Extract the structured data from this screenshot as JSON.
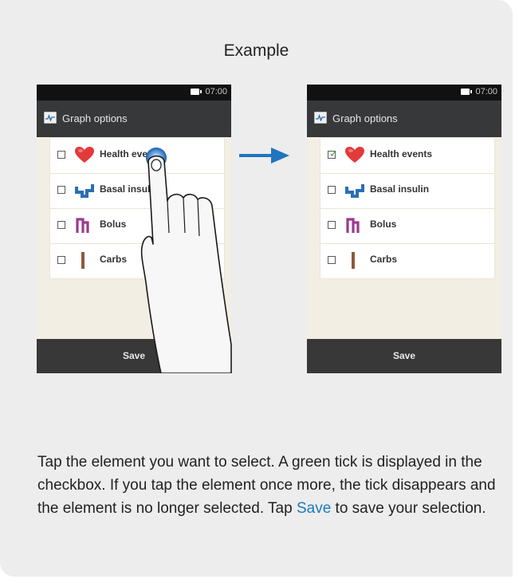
{
  "example_title": "Example",
  "phones": {
    "left": {
      "clock": "07:00",
      "header_title": "Graph options",
      "items": [
        {
          "label": "Health events",
          "checked": false
        },
        {
          "label": "Basal insulin",
          "checked": false
        },
        {
          "label": "Bolus",
          "checked": false
        },
        {
          "label": "Carbs",
          "checked": false
        }
      ],
      "footer_button": "Save"
    },
    "right": {
      "clock": "07:00",
      "header_title": "Graph options",
      "items": [
        {
          "label": "Health events",
          "checked": true
        },
        {
          "label": "Basal insulin",
          "checked": false
        },
        {
          "label": "Bolus",
          "checked": false
        },
        {
          "label": "Carbs",
          "checked": false
        }
      ],
      "footer_button": "Save"
    }
  },
  "description": {
    "part1": "Tap the element you want to select. A green tick is displayed in the checkbox. If you tap the element once more, the tick disappears and the element is no longer selected. Tap ",
    "highlight": "Save",
    "part2": " to save your selection."
  },
  "icons": {
    "health": "heart-icon",
    "basal": "basal-insulin-icon",
    "bolus": "bolus-icon",
    "carbs": "carbs-icon",
    "arrow": "arrow-right-icon",
    "hand": "tapping-hand-icon"
  },
  "colors": {
    "panel_bg": "#ededed",
    "phone_bg": "#f3eee3",
    "header_bg": "#37383a",
    "footer_bg": "#383838",
    "heart": "#e23a3a",
    "basal": "#2a6fb5",
    "bolus": "#9a3a8e",
    "carbs": "#8b5a3c",
    "tick": "#3aa13a",
    "arrow": "#1f75bf",
    "save_link": "#1b7ac2"
  }
}
